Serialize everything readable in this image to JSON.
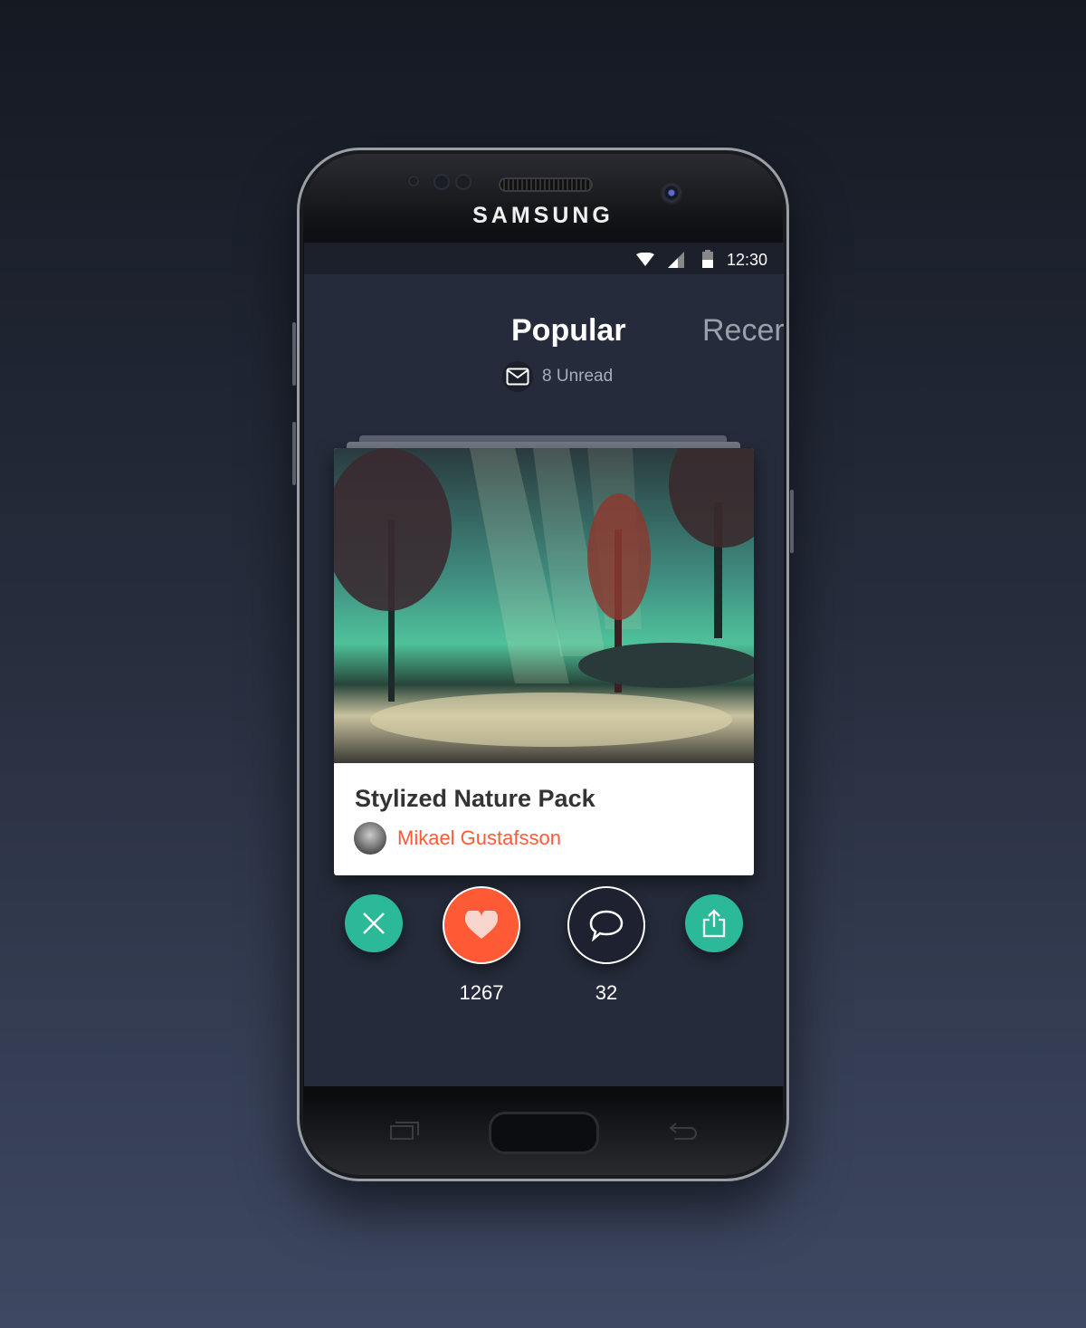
{
  "device": {
    "brand": "SAMSUNG"
  },
  "status_bar": {
    "time": "12:30",
    "icons": [
      "wifi-icon",
      "signal-icon",
      "battery-icon"
    ]
  },
  "tabs": [
    {
      "label": "Popular",
      "active": true
    },
    {
      "label": "Recer",
      "active": false
    }
  ],
  "unread": {
    "label": "8 Unread",
    "icon": "mail-icon"
  },
  "card": {
    "title": "Stylized Nature Pack",
    "author": "Mikael Gustafsson"
  },
  "actions": {
    "likes": "1267",
    "comments": "32"
  },
  "colors": {
    "accent": "#ff5a36",
    "teal": "#2bb99a",
    "background": "#252b3a"
  }
}
